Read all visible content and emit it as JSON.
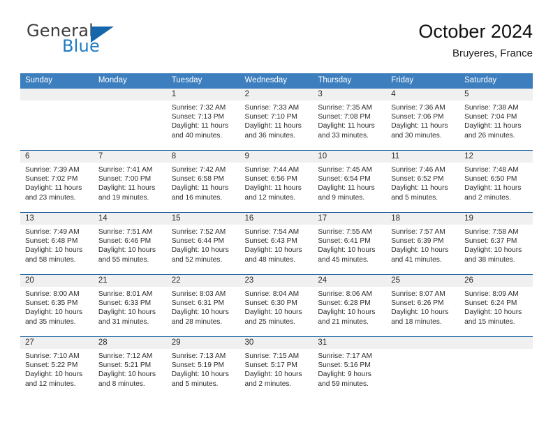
{
  "brand": {
    "name_part1": "General",
    "name_part2": "Blue",
    "logo_icon": "blue-triangle-icon",
    "color_dark": "#3c3c3c",
    "color_blue": "#1b7bc4"
  },
  "header": {
    "title": "October 2024",
    "subtitle": "Bruyeres, France",
    "accent_color": "#3c7ebe",
    "header_border_color": "#1a5fa0",
    "daynum_strip_color": "#f0f0f0"
  },
  "weekday_headers": [
    "Sunday",
    "Monday",
    "Tuesday",
    "Wednesday",
    "Thursday",
    "Friday",
    "Saturday"
  ],
  "weeks": [
    [
      {
        "day": "",
        "blank": true,
        "sunrise": "",
        "sunset": "",
        "daylight1": "",
        "daylight2": ""
      },
      {
        "day": "",
        "blank": true,
        "sunrise": "",
        "sunset": "",
        "daylight1": "",
        "daylight2": ""
      },
      {
        "day": "1",
        "sunrise": "Sunrise: 7:32 AM",
        "sunset": "Sunset: 7:13 PM",
        "daylight1": "Daylight: 11 hours",
        "daylight2": "and 40 minutes."
      },
      {
        "day": "2",
        "sunrise": "Sunrise: 7:33 AM",
        "sunset": "Sunset: 7:10 PM",
        "daylight1": "Daylight: 11 hours",
        "daylight2": "and 36 minutes."
      },
      {
        "day": "3",
        "sunrise": "Sunrise: 7:35 AM",
        "sunset": "Sunset: 7:08 PM",
        "daylight1": "Daylight: 11 hours",
        "daylight2": "and 33 minutes."
      },
      {
        "day": "4",
        "sunrise": "Sunrise: 7:36 AM",
        "sunset": "Sunset: 7:06 PM",
        "daylight1": "Daylight: 11 hours",
        "daylight2": "and 30 minutes."
      },
      {
        "day": "5",
        "sunrise": "Sunrise: 7:38 AM",
        "sunset": "Sunset: 7:04 PM",
        "daylight1": "Daylight: 11 hours",
        "daylight2": "and 26 minutes."
      }
    ],
    [
      {
        "day": "6",
        "sunrise": "Sunrise: 7:39 AM",
        "sunset": "Sunset: 7:02 PM",
        "daylight1": "Daylight: 11 hours",
        "daylight2": "and 23 minutes."
      },
      {
        "day": "7",
        "sunrise": "Sunrise: 7:41 AM",
        "sunset": "Sunset: 7:00 PM",
        "daylight1": "Daylight: 11 hours",
        "daylight2": "and 19 minutes."
      },
      {
        "day": "8",
        "sunrise": "Sunrise: 7:42 AM",
        "sunset": "Sunset: 6:58 PM",
        "daylight1": "Daylight: 11 hours",
        "daylight2": "and 16 minutes."
      },
      {
        "day": "9",
        "sunrise": "Sunrise: 7:44 AM",
        "sunset": "Sunset: 6:56 PM",
        "daylight1": "Daylight: 11 hours",
        "daylight2": "and 12 minutes."
      },
      {
        "day": "10",
        "sunrise": "Sunrise: 7:45 AM",
        "sunset": "Sunset: 6:54 PM",
        "daylight1": "Daylight: 11 hours",
        "daylight2": "and 9 minutes."
      },
      {
        "day": "11",
        "sunrise": "Sunrise: 7:46 AM",
        "sunset": "Sunset: 6:52 PM",
        "daylight1": "Daylight: 11 hours",
        "daylight2": "and 5 minutes."
      },
      {
        "day": "12",
        "sunrise": "Sunrise: 7:48 AM",
        "sunset": "Sunset: 6:50 PM",
        "daylight1": "Daylight: 11 hours",
        "daylight2": "and 2 minutes."
      }
    ],
    [
      {
        "day": "13",
        "sunrise": "Sunrise: 7:49 AM",
        "sunset": "Sunset: 6:48 PM",
        "daylight1": "Daylight: 10 hours",
        "daylight2": "and 58 minutes."
      },
      {
        "day": "14",
        "sunrise": "Sunrise: 7:51 AM",
        "sunset": "Sunset: 6:46 PM",
        "daylight1": "Daylight: 10 hours",
        "daylight2": "and 55 minutes."
      },
      {
        "day": "15",
        "sunrise": "Sunrise: 7:52 AM",
        "sunset": "Sunset: 6:44 PM",
        "daylight1": "Daylight: 10 hours",
        "daylight2": "and 52 minutes."
      },
      {
        "day": "16",
        "sunrise": "Sunrise: 7:54 AM",
        "sunset": "Sunset: 6:43 PM",
        "daylight1": "Daylight: 10 hours",
        "daylight2": "and 48 minutes."
      },
      {
        "day": "17",
        "sunrise": "Sunrise: 7:55 AM",
        "sunset": "Sunset: 6:41 PM",
        "daylight1": "Daylight: 10 hours",
        "daylight2": "and 45 minutes."
      },
      {
        "day": "18",
        "sunrise": "Sunrise: 7:57 AM",
        "sunset": "Sunset: 6:39 PM",
        "daylight1": "Daylight: 10 hours",
        "daylight2": "and 41 minutes."
      },
      {
        "day": "19",
        "sunrise": "Sunrise: 7:58 AM",
        "sunset": "Sunset: 6:37 PM",
        "daylight1": "Daylight: 10 hours",
        "daylight2": "and 38 minutes."
      }
    ],
    [
      {
        "day": "20",
        "sunrise": "Sunrise: 8:00 AM",
        "sunset": "Sunset: 6:35 PM",
        "daylight1": "Daylight: 10 hours",
        "daylight2": "and 35 minutes."
      },
      {
        "day": "21",
        "sunrise": "Sunrise: 8:01 AM",
        "sunset": "Sunset: 6:33 PM",
        "daylight1": "Daylight: 10 hours",
        "daylight2": "and 31 minutes."
      },
      {
        "day": "22",
        "sunrise": "Sunrise: 8:03 AM",
        "sunset": "Sunset: 6:31 PM",
        "daylight1": "Daylight: 10 hours",
        "daylight2": "and 28 minutes."
      },
      {
        "day": "23",
        "sunrise": "Sunrise: 8:04 AM",
        "sunset": "Sunset: 6:30 PM",
        "daylight1": "Daylight: 10 hours",
        "daylight2": "and 25 minutes."
      },
      {
        "day": "24",
        "sunrise": "Sunrise: 8:06 AM",
        "sunset": "Sunset: 6:28 PM",
        "daylight1": "Daylight: 10 hours",
        "daylight2": "and 21 minutes."
      },
      {
        "day": "25",
        "sunrise": "Sunrise: 8:07 AM",
        "sunset": "Sunset: 6:26 PM",
        "daylight1": "Daylight: 10 hours",
        "daylight2": "and 18 minutes."
      },
      {
        "day": "26",
        "sunrise": "Sunrise: 8:09 AM",
        "sunset": "Sunset: 6:24 PM",
        "daylight1": "Daylight: 10 hours",
        "daylight2": "and 15 minutes."
      }
    ],
    [
      {
        "day": "27",
        "sunrise": "Sunrise: 7:10 AM",
        "sunset": "Sunset: 5:22 PM",
        "daylight1": "Daylight: 10 hours",
        "daylight2": "and 12 minutes."
      },
      {
        "day": "28",
        "sunrise": "Sunrise: 7:12 AM",
        "sunset": "Sunset: 5:21 PM",
        "daylight1": "Daylight: 10 hours",
        "daylight2": "and 8 minutes."
      },
      {
        "day": "29",
        "sunrise": "Sunrise: 7:13 AM",
        "sunset": "Sunset: 5:19 PM",
        "daylight1": "Daylight: 10 hours",
        "daylight2": "and 5 minutes."
      },
      {
        "day": "30",
        "sunrise": "Sunrise: 7:15 AM",
        "sunset": "Sunset: 5:17 PM",
        "daylight1": "Daylight: 10 hours",
        "daylight2": "and 2 minutes."
      },
      {
        "day": "31",
        "sunrise": "Sunrise: 7:17 AM",
        "sunset": "Sunset: 5:16 PM",
        "daylight1": "Daylight: 9 hours",
        "daylight2": "and 59 minutes."
      },
      {
        "day": "",
        "blank": true,
        "sunrise": "",
        "sunset": "",
        "daylight1": "",
        "daylight2": ""
      },
      {
        "day": "",
        "blank": true,
        "sunrise": "",
        "sunset": "",
        "daylight1": "",
        "daylight2": ""
      }
    ]
  ]
}
